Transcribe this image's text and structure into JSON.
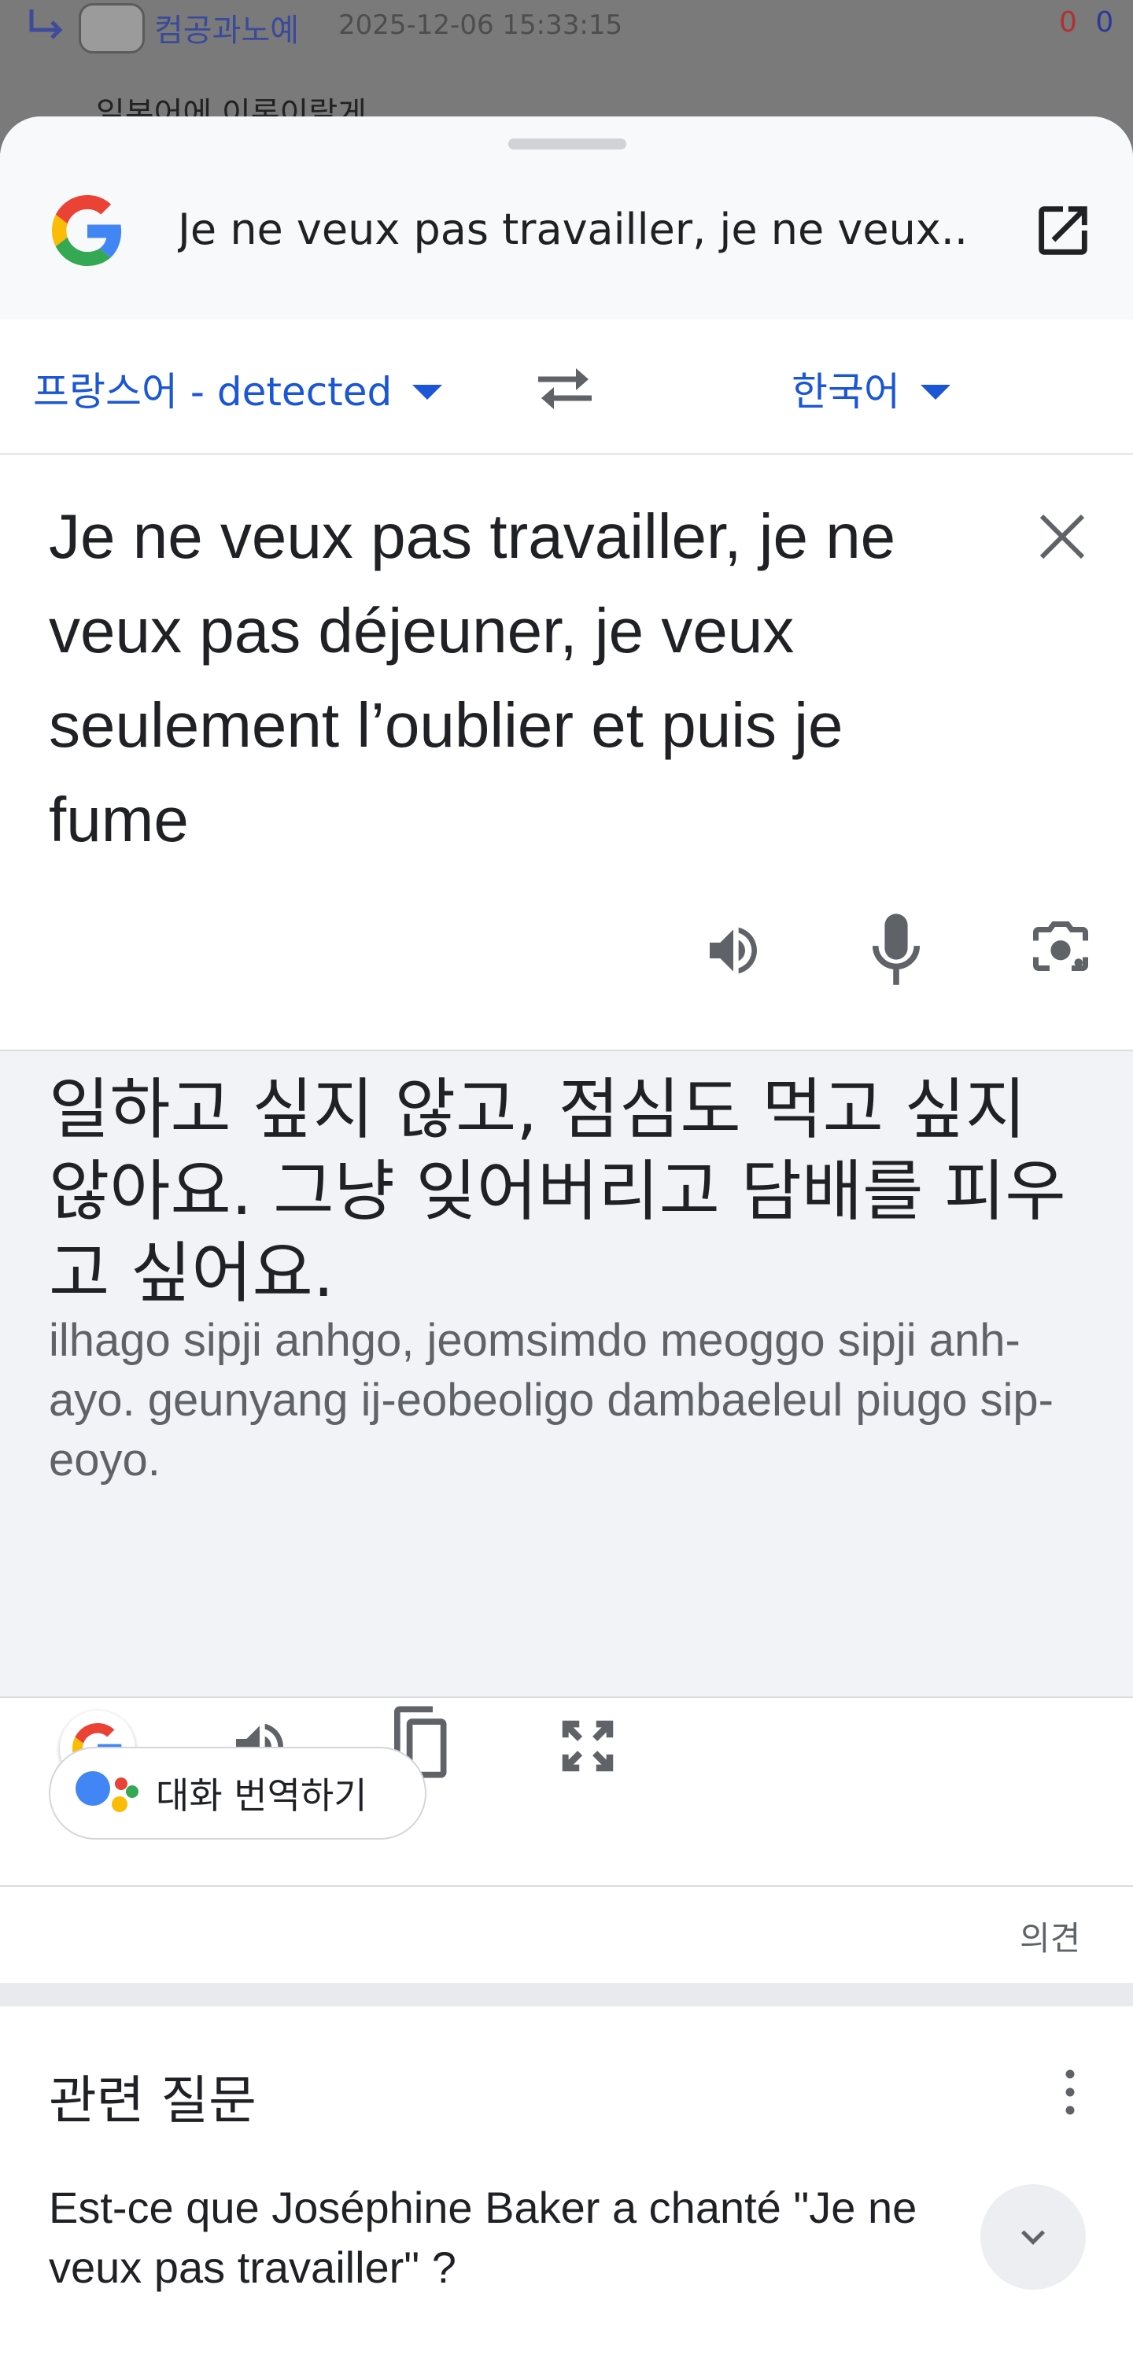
{
  "background": {
    "author": "컴공과노예",
    "date": "2025-12-06 15:33:15",
    "upvotes": "0",
    "downvotes": "0",
    "comment": "일본어에 이론이랄게"
  },
  "header": {
    "query": "Je ne veux pas travailler, je ne veux..."
  },
  "languages": {
    "source": "프랑스어 - detected",
    "target": "한국어"
  },
  "source": {
    "text": "Je ne veux pas travailler, je ne veux pas déjeuner, je veux seulement l’oublier et puis je fume"
  },
  "translation": {
    "text": "일하고 싶지 않고, 점심도 먹고 싶지 않아요. 그냥 잊어버리고 담배를 피우고 싶어요.",
    "romanized": "ilhago sipji anhgo, jeomsimdo meoggo sipji anh-ayo. geunyang ij-eobeoligo dambaeleul piugo sip-eoyo."
  },
  "conversation": {
    "label": "대화 번역하기"
  },
  "feedback": {
    "label": "의견"
  },
  "related": {
    "title": "관련 질문",
    "question": "Est-ce que Joséphine Baker a chanté \"Je ne veux pas travailler\" ?"
  },
  "colors": {
    "accent": "#1a56d6",
    "google_blue": "#4285F4",
    "google_red": "#EA4335",
    "google_yellow": "#FBBC05",
    "google_green": "#34A853"
  },
  "icons": {
    "header_logo": "google-g-icon",
    "open": "open-in-new-icon",
    "swap": "swap-icon",
    "clear": "close-icon",
    "speaker": "speaker-icon",
    "mic": "mic-icon",
    "lens": "camera-lens-icon",
    "copy": "copy-icon",
    "fullscreen": "fullscreen-icon",
    "assistant": "assistant-icon",
    "more": "more-vert-icon",
    "expand": "chevron-down-icon"
  }
}
